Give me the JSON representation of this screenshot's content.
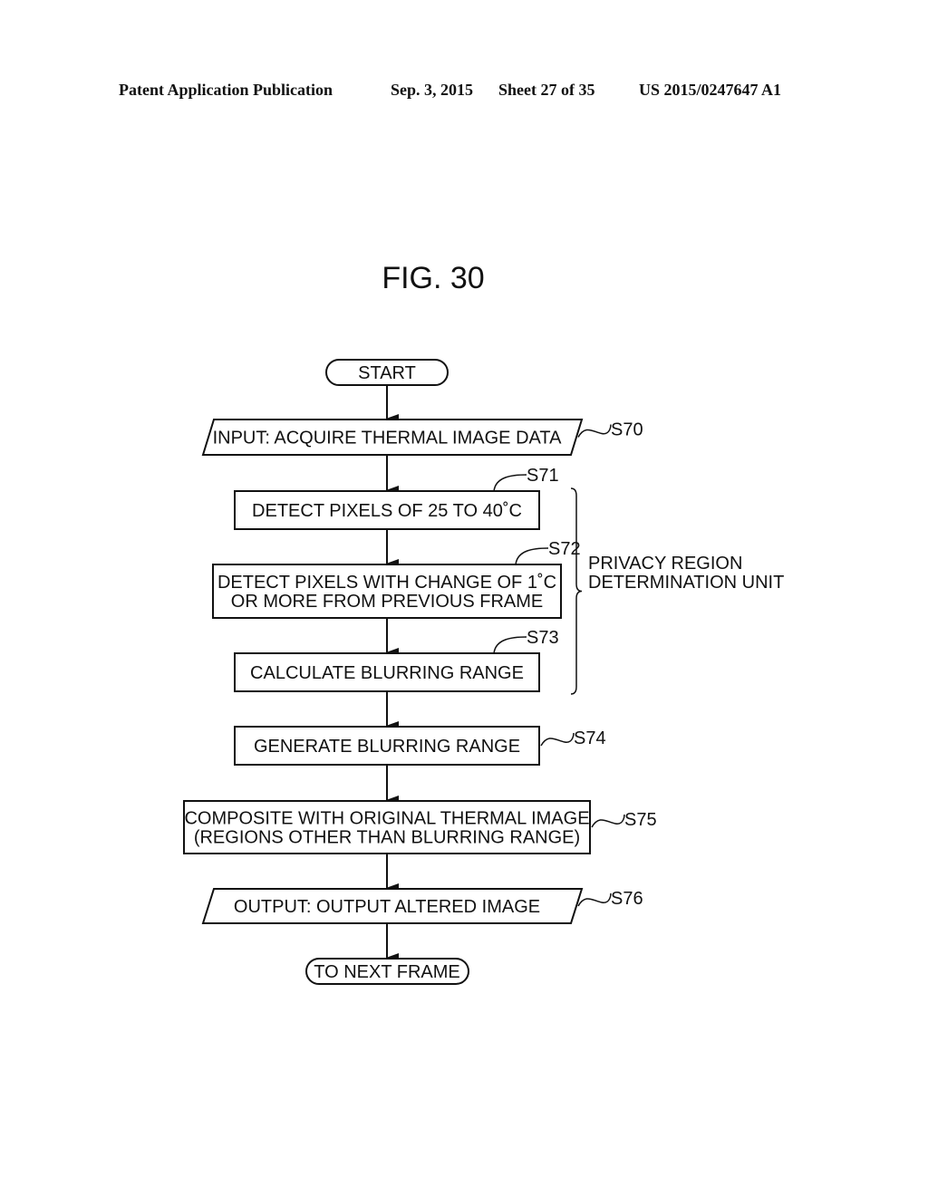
{
  "header": {
    "publication": "Patent Application Publication",
    "date": "Sep. 3, 2015",
    "sheet": "Sheet 27 of 35",
    "number": "US 2015/0247647 A1"
  },
  "figure": {
    "title": "FIG. 30"
  },
  "flowchart": {
    "nodes": [
      {
        "id": "start",
        "shape": "terminal",
        "lines": [
          "START"
        ],
        "step": ""
      },
      {
        "id": "s70",
        "shape": "parallelogram",
        "lines": [
          "INPUT: ACQUIRE THERMAL IMAGE DATA"
        ],
        "step": "S70"
      },
      {
        "id": "s71",
        "shape": "process",
        "lines": [
          "DETECT PIXELS OF 25 TO 40˚C"
        ],
        "step": "S71"
      },
      {
        "id": "s72",
        "shape": "process",
        "lines": [
          "DETECT PIXELS WITH CHANGE OF 1˚C",
          "OR MORE FROM PREVIOUS FRAME"
        ],
        "step": "S72"
      },
      {
        "id": "s73",
        "shape": "process",
        "lines": [
          "CALCULATE BLURRING RANGE"
        ],
        "step": "S73"
      },
      {
        "id": "s74",
        "shape": "process",
        "lines": [
          "GENERATE BLURRING RANGE"
        ],
        "step": "S74"
      },
      {
        "id": "s75",
        "shape": "process",
        "lines": [
          "COMPOSITE WITH ORIGINAL THERMAL IMAGE",
          "(REGIONS OTHER THAN BLURRING RANGE)"
        ],
        "step": "S75"
      },
      {
        "id": "s76",
        "shape": "parallelogram",
        "lines": [
          "OUTPUT: OUTPUT ALTERED IMAGE"
        ],
        "step": "S76"
      },
      {
        "id": "end",
        "shape": "terminal",
        "lines": [
          "TO NEXT FRAME"
        ],
        "step": ""
      }
    ],
    "edges": [
      [
        "start",
        "s70"
      ],
      [
        "s70",
        "s71"
      ],
      [
        "s71",
        "s72"
      ],
      [
        "s72",
        "s73"
      ],
      [
        "s73",
        "s74"
      ],
      [
        "s74",
        "s75"
      ],
      [
        "s75",
        "s76"
      ],
      [
        "s76",
        "end"
      ]
    ],
    "group": {
      "lines": [
        "PRIVACY REGION",
        "DETERMINATION UNIT"
      ],
      "members": [
        "s71",
        "s72",
        "s73"
      ]
    }
  }
}
